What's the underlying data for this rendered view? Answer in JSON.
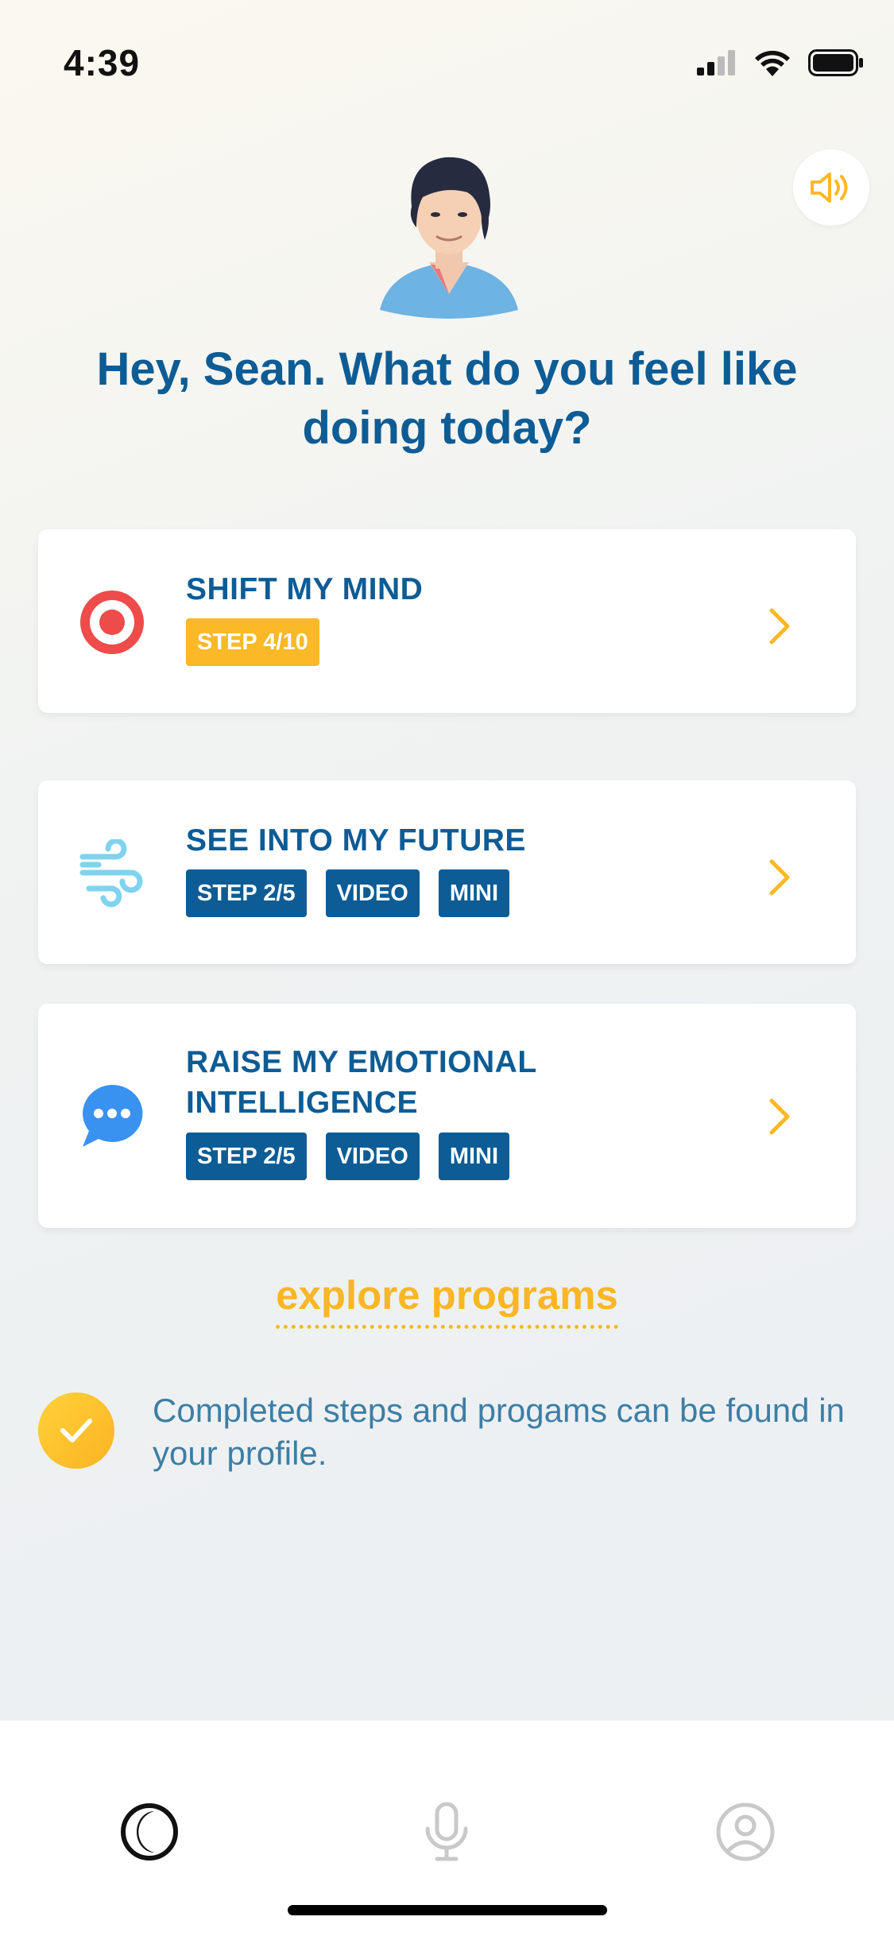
{
  "status_bar": {
    "time": "4:39"
  },
  "greeting": "Hey, Sean. What do you feel like doing today?",
  "cards": [
    {
      "title": "SHIFT MY MIND",
      "icon": "target-icon",
      "tags": [
        "STEP 4/10"
      ]
    },
    {
      "title": "SEE INTO MY FUTURE",
      "icon": "wind-icon",
      "tags": [
        "STEP 2/5",
        "VIDEO",
        "MINI"
      ]
    },
    {
      "title": "RAISE MY EMOTIONAL INTELLIGENCE",
      "icon": "chat-bubble-icon",
      "tags": [
        "STEP 2/5",
        "VIDEO",
        "MINI"
      ]
    }
  ],
  "explore_link": "explore programs",
  "note": "Completed steps and progams can be found in your profile.",
  "tab_bar": {
    "items": [
      "home-icon",
      "microphone-icon",
      "profile-icon"
    ]
  },
  "colors": {
    "primary": "#0d5c95",
    "accent": "#fbb827",
    "target_red": "#ee4b4b",
    "wind_blue": "#7fd3ee",
    "chat_blue": "#3a92f0"
  }
}
